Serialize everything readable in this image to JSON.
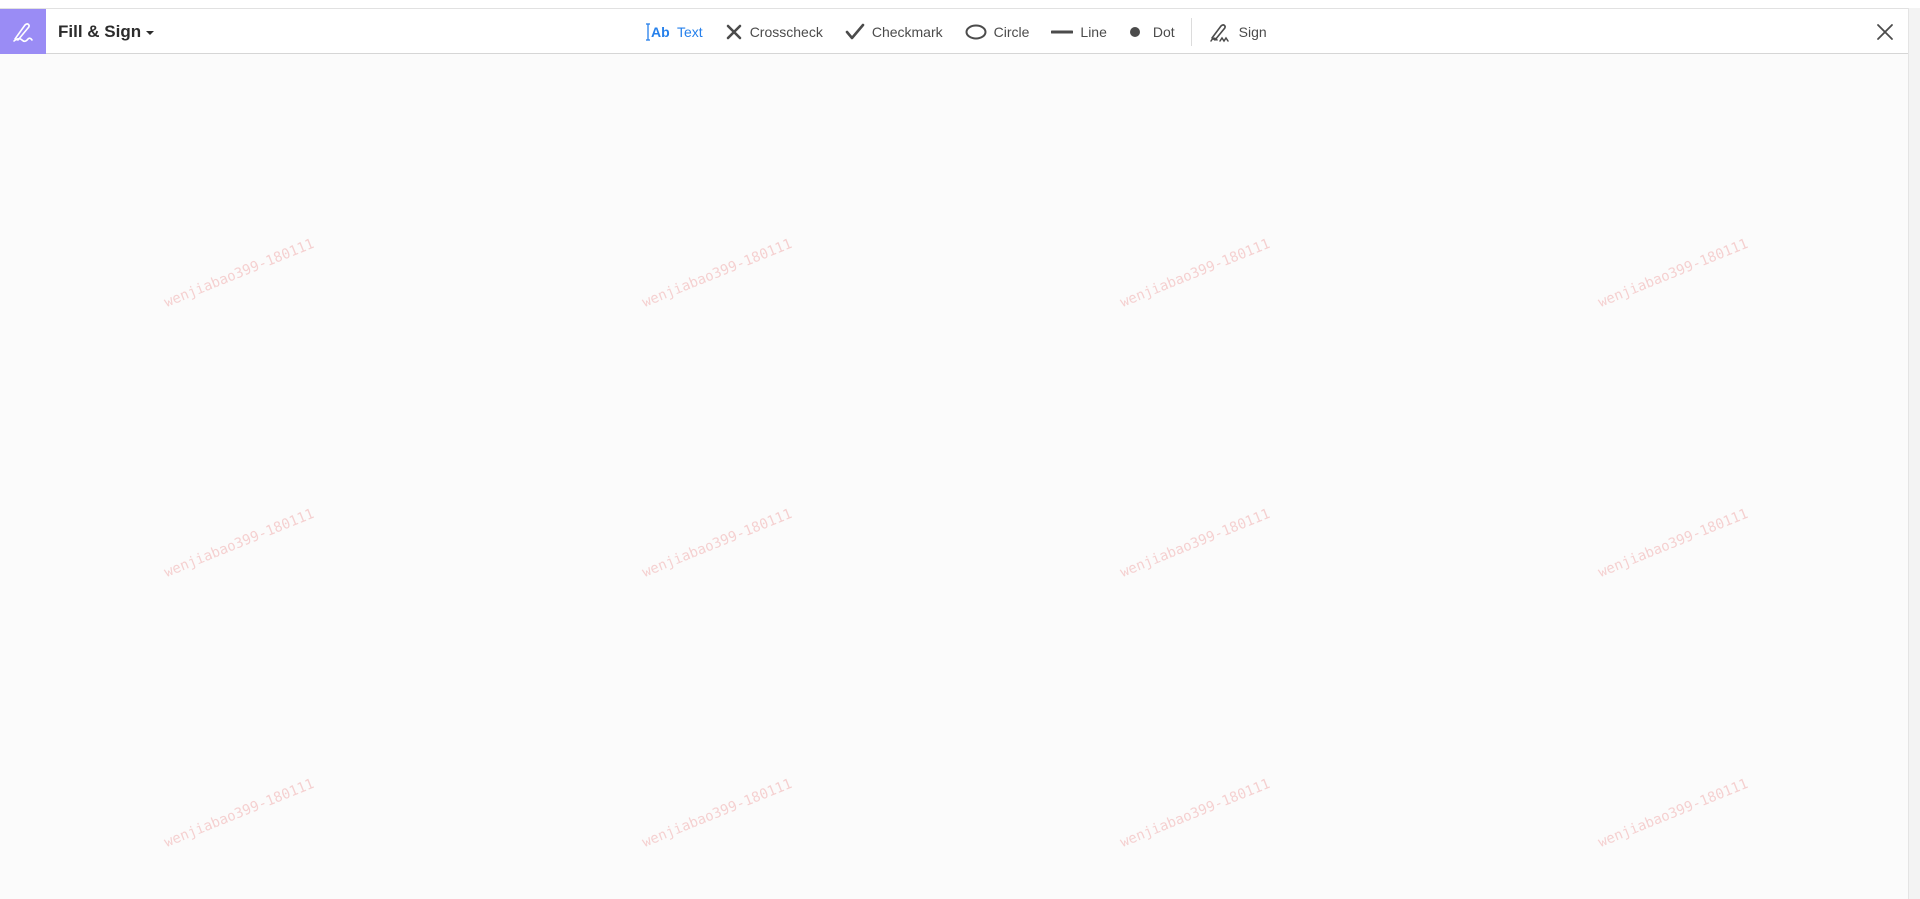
{
  "header": {
    "title": "Fill & Sign",
    "close_icon": "close-icon"
  },
  "tools": [
    {
      "id": "text",
      "label": "Text",
      "icon": "text-tool-icon",
      "active": true
    },
    {
      "id": "crosscheck",
      "label": "Crosscheck",
      "icon": "cross-icon",
      "active": false
    },
    {
      "id": "checkmark",
      "label": "Checkmark",
      "icon": "checkmark-icon",
      "active": false
    },
    {
      "id": "circle",
      "label": "Circle",
      "icon": "circle-icon",
      "active": false
    },
    {
      "id": "line",
      "label": "Line",
      "icon": "line-icon",
      "active": false
    },
    {
      "id": "dot",
      "label": "Dot",
      "icon": "dot-icon",
      "active": false
    },
    {
      "id": "sign",
      "label": "Sign",
      "icon": "sign-pen-icon",
      "active": false
    }
  ],
  "watermark": {
    "text": "wenjiabao399-180111"
  },
  "colors": {
    "accent": "#2680eb",
    "app_icon_bg": "#9a8cf5"
  }
}
